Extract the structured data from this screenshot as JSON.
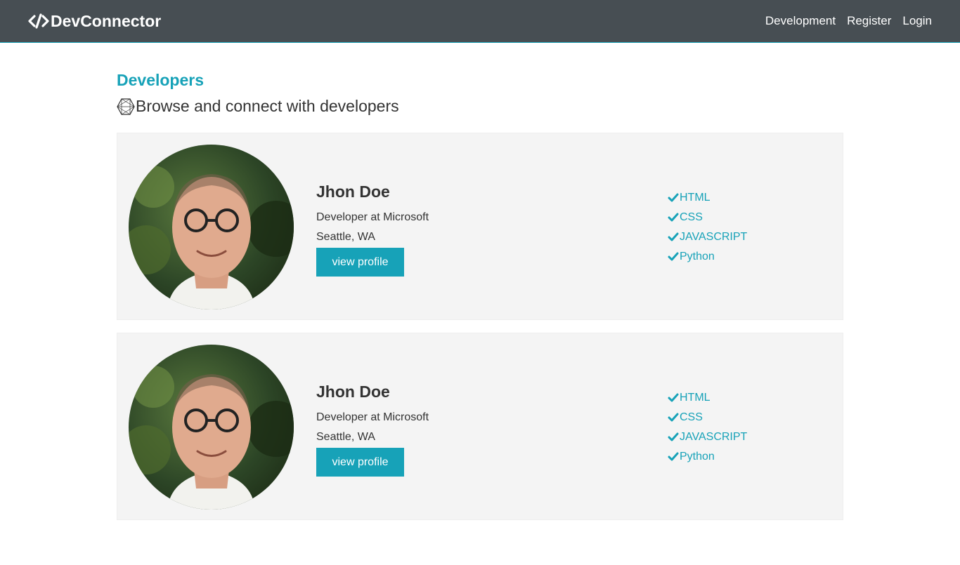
{
  "navbar": {
    "brand": "DevConnector",
    "brand_icon": "code-icon",
    "links": [
      "Development",
      "Register",
      "Login"
    ]
  },
  "page": {
    "title": "Developers",
    "lead": "Browse and connect with developers",
    "lead_icon": "connect-develop-icon"
  },
  "profiles": [
    {
      "name": "Jhon Doe",
      "status": "Developer at Microsoft",
      "location": "Seattle, WA",
      "button_label": "view profile",
      "skills": [
        "HTML",
        "CSS",
        "JAVASCRIPT",
        "Python"
      ]
    },
    {
      "name": "Jhon Doe",
      "status": "Developer at Microsoft",
      "location": "Seattle, WA",
      "button_label": "view profile",
      "skills": [
        "HTML",
        "CSS",
        "JAVASCRIPT",
        "Python"
      ]
    }
  ],
  "colors": {
    "navbar": "#474e53",
    "primary": "#17a2b8",
    "card": "#f4f4f4",
    "text": "#333333"
  }
}
